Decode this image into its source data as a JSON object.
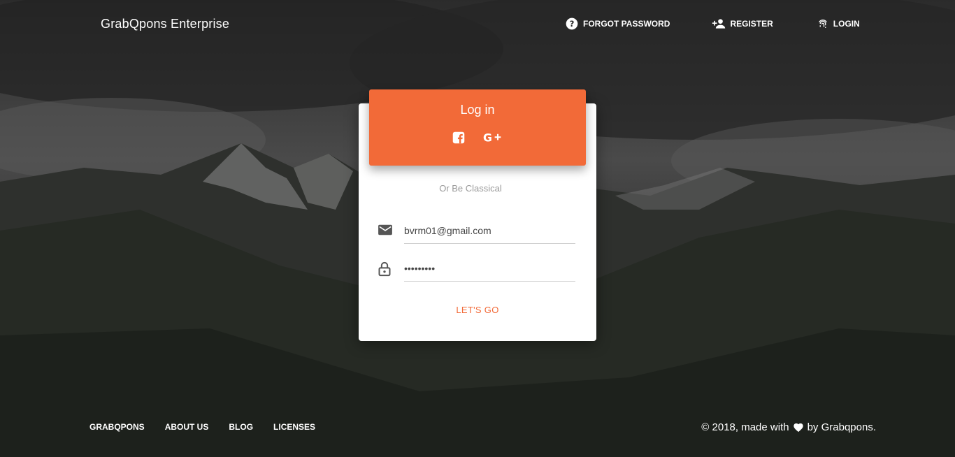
{
  "brand": "GrabQpons Enterprise",
  "nav": {
    "forgot": "FORGOT PASSWORD",
    "register": "REGISTER",
    "login": "LOGIN"
  },
  "card": {
    "title": "Log in",
    "subtitle": "Or Be Classical",
    "email_value": "bvrm01@gmail.com",
    "password_value": "•••••••••",
    "submit": "LET'S GO"
  },
  "footer": {
    "links": [
      "GRABQPONS",
      "ABOUT US",
      "BLOG",
      "LICENSES"
    ],
    "copyright_before": "© 2018, made with",
    "copyright_after": "by Grabqpons."
  },
  "icons": {
    "social": [
      "facebook-icon",
      "google-plus-icon"
    ],
    "fields": [
      "email-icon",
      "lock-icon"
    ]
  },
  "colors": {
    "accent": "#f26a38",
    "background": "#1f2320"
  }
}
